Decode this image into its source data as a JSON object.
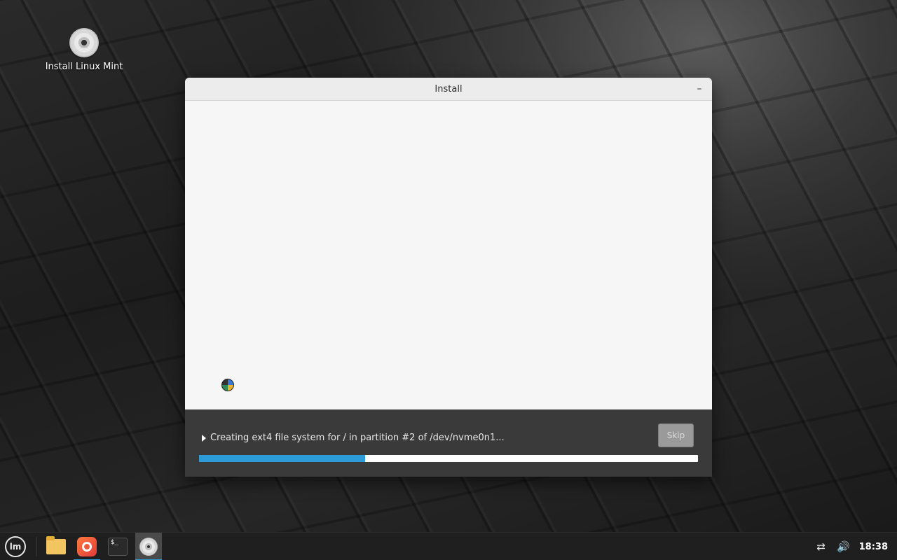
{
  "desktop": {
    "icons": [
      {
        "label": "Install Linux Mint",
        "icon": "disc-icon"
      }
    ]
  },
  "window": {
    "title": "Install",
    "minimize_symbol": "–",
    "status_text": "Creating ext4 file system for / in partition #2 of /dev/nvme0n1...",
    "skip_label": "Skip",
    "progress_fraction": 0.333,
    "colors": {
      "progress_fill": "#2d9bd8",
      "progress_track": "#ffffff",
      "bottom_bar": "#3a3a3a",
      "slideshow_bg": "#f6f6f6"
    }
  },
  "taskbar": {
    "menu_label": "lm",
    "launchers": [
      {
        "name": "files",
        "icon": "folder-icon"
      },
      {
        "name": "firefox",
        "icon": "firefox-icon"
      },
      {
        "name": "terminal",
        "icon": "terminal-icon",
        "glyph": "$_"
      },
      {
        "name": "installer",
        "icon": "disc-icon"
      }
    ],
    "tray": {
      "network_icon": "⇄",
      "volume_icon": "🔊",
      "clock": "18:38"
    }
  }
}
